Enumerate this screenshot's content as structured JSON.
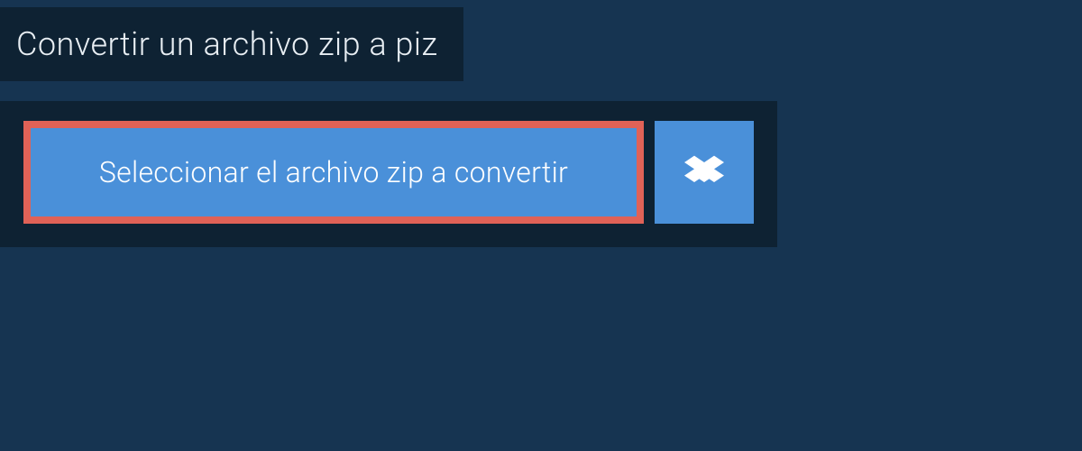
{
  "header": {
    "title": "Convertir un archivo zip a piz"
  },
  "upload": {
    "select_label": "Seleccionar el archivo zip a convertir"
  },
  "colors": {
    "bg_outer": "#163451",
    "bg_inner": "#0e2233",
    "button_blue": "#4a90d9",
    "highlight_border": "#e06257",
    "text_light": "#e8eef3"
  }
}
